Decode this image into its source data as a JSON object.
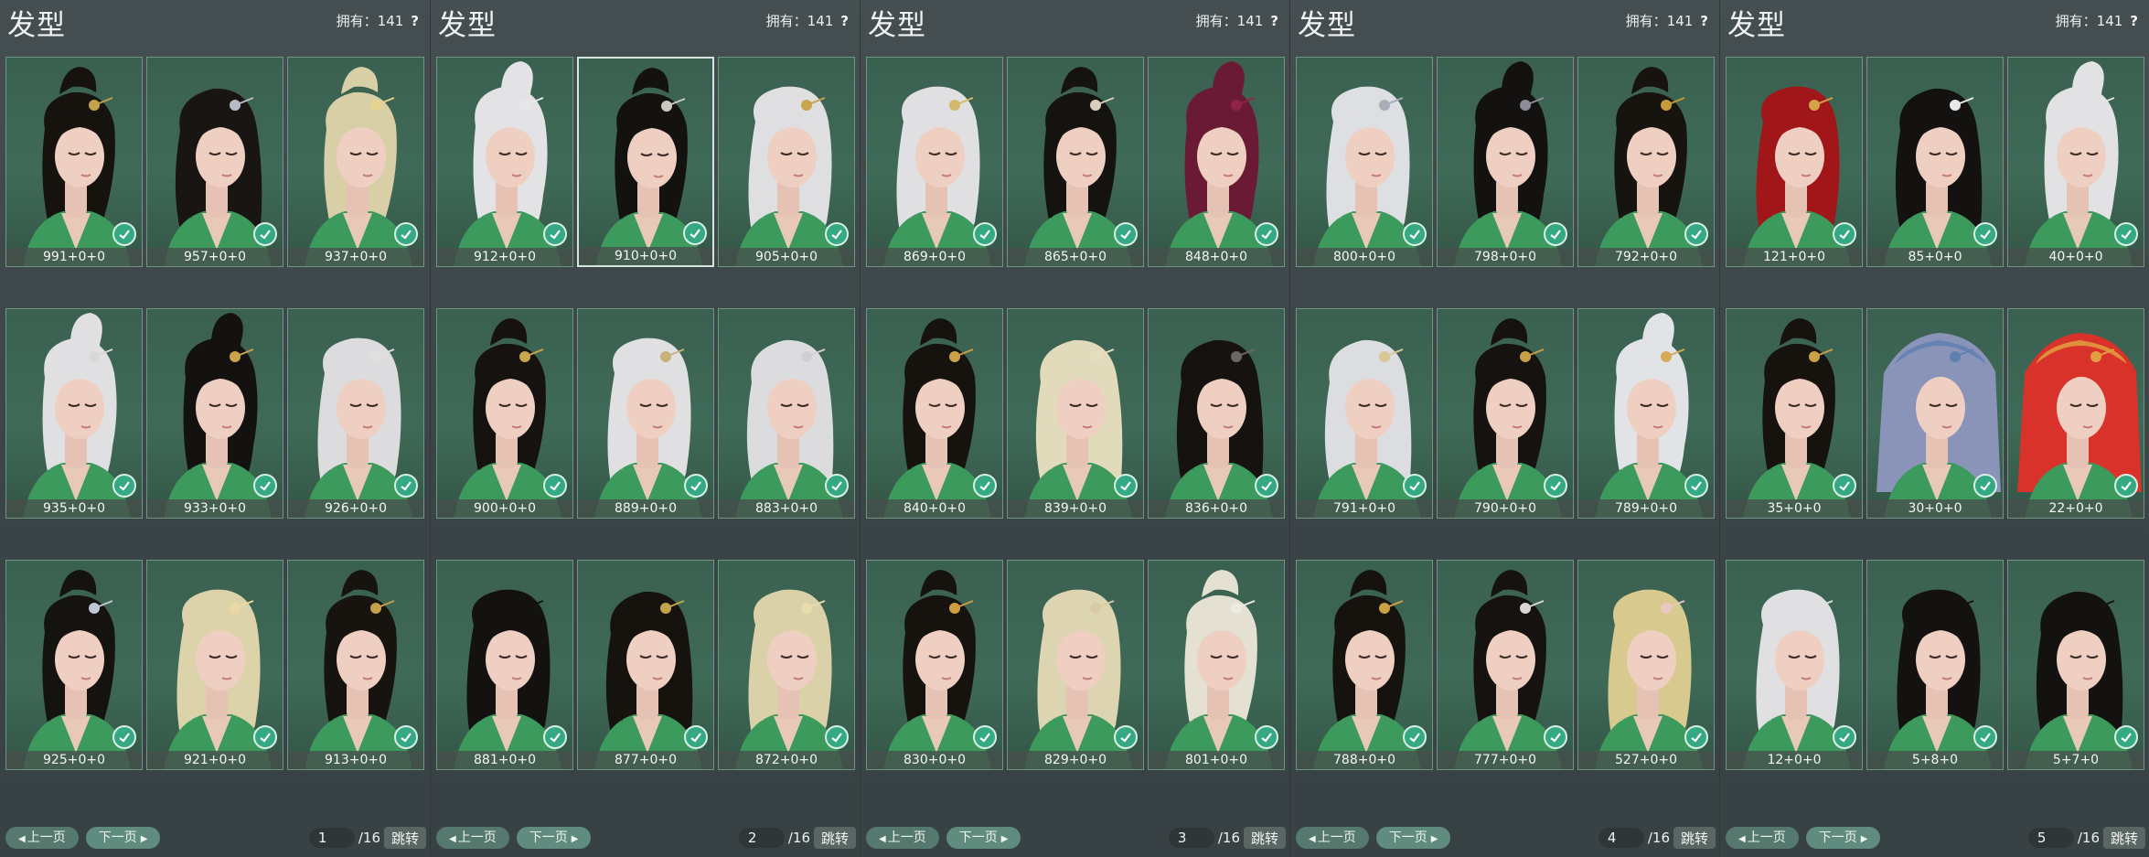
{
  "colors": {
    "panel_bg": "#3d4648",
    "card_bg": "#3f6a58",
    "card_border": "#6e9584",
    "check": "#35a884",
    "button": "#5f8c7e"
  },
  "panels": [
    {
      "title": "发型",
      "owned": "拥有：141",
      "help": "?",
      "page": "1",
      "total": "/16",
      "prev": "上一页",
      "next": "下一页",
      "jump": "跳转",
      "items": [
        {
          "code": "991+0+0",
          "hair": "#16130f",
          "acc": "#c6a248",
          "style": "bun",
          "selected": false
        },
        {
          "code": "957+0+0",
          "hair": "#181513",
          "acc": "#b8bac6",
          "style": "side",
          "selected": false
        },
        {
          "code": "937+0+0",
          "hair": "#d9cfa7",
          "acc": "#e6d38c",
          "style": "bun",
          "selected": false
        },
        {
          "code": "935+0+0",
          "hair": "#e0e0e2",
          "acc": "#d8d8d8",
          "style": "pony",
          "selected": false
        },
        {
          "code": "933+0+0",
          "hair": "#141210",
          "acc": "#c9a44c",
          "style": "pony",
          "selected": false
        },
        {
          "code": "926+0+0",
          "hair": "#dcdcdf",
          "acc": "#e0e0e0",
          "style": "long",
          "selected": false
        },
        {
          "code": "925+0+0",
          "hair": "#15130f",
          "acc": "#bfc7d6",
          "style": "bun",
          "selected": false
        },
        {
          "code": "921+0+0",
          "hair": "#ddd3ab",
          "acc": "#ead8a3",
          "style": "long",
          "selected": false
        },
        {
          "code": "913+0+0",
          "hair": "#17140f",
          "acc": "#c4a04c",
          "style": "bun",
          "selected": false
        }
      ]
    },
    {
      "title": "发型",
      "owned": "拥有：141",
      "help": "?",
      "page": "2",
      "total": "/16",
      "prev": "上一页",
      "next": "下一页",
      "jump": "跳转",
      "items": [
        {
          "code": "912+0+0",
          "hair": "#e3e3e6",
          "acc": "#e8e8ea",
          "style": "pony",
          "selected": false
        },
        {
          "code": "910+0+0",
          "hair": "#141210",
          "acc": "#cbc8c2",
          "style": "bun",
          "selected": true
        },
        {
          "code": "905+0+0",
          "hair": "#dfdfe1",
          "acc": "#caa44e",
          "style": "long",
          "selected": false
        },
        {
          "code": "900+0+0",
          "hair": "#15120f",
          "acc": "#c9a74e",
          "style": "bun",
          "selected": false
        },
        {
          "code": "889+0+0",
          "hair": "#e0e0e2",
          "acc": "#c7b27a",
          "style": "long",
          "selected": false
        },
        {
          "code": "883+0+0",
          "hair": "#dcdcdf",
          "acc": "#d0d0d4",
          "style": "side",
          "selected": false
        },
        {
          "code": "881+0+0",
          "hair": "#141210",
          "acc": "#141210",
          "style": "long",
          "selected": false
        },
        {
          "code": "877+0+0",
          "hair": "#16130f",
          "acc": "#c3a34e",
          "style": "side",
          "selected": false
        },
        {
          "code": "872+0+0",
          "hair": "#dad1a9",
          "acc": "#e9dcae",
          "style": "long",
          "selected": false
        }
      ]
    },
    {
      "title": "发型",
      "owned": "拥有：141",
      "help": "?",
      "page": "3",
      "total": "/16",
      "prev": "上一页",
      "next": "下一页",
      "jump": "跳转",
      "items": [
        {
          "code": "869+0+0",
          "hair": "#e0e0e3",
          "acc": "#d4b86c",
          "style": "long",
          "selected": false
        },
        {
          "code": "865+0+0",
          "hair": "#15130f",
          "acc": "#d8d0bc",
          "style": "bun",
          "selected": false
        },
        {
          "code": "848+0+0",
          "hair": "#6b1a36",
          "acc": "#8f2446",
          "style": "pony",
          "selected": false
        },
        {
          "code": "840+0+0",
          "hair": "#16120e",
          "acc": "#caa148",
          "style": "bun",
          "selected": false
        },
        {
          "code": "839+0+0",
          "hair": "#e1dbbc",
          "acc": "#e6dfbf",
          "style": "side",
          "selected": false
        },
        {
          "code": "836+0+0",
          "hair": "#15120f",
          "acc": "#6b6766",
          "style": "side",
          "selected": false
        },
        {
          "code": "830+0+0",
          "hair": "#16120e",
          "acc": "#cf9d3e",
          "style": "bun",
          "selected": false
        },
        {
          "code": "829+0+0",
          "hair": "#ddd5b1",
          "acc": "#d9c9a4",
          "style": "long",
          "selected": false
        },
        {
          "code": "801+0+0",
          "hair": "#e4e0d2",
          "acc": "#eeeae0",
          "style": "bun",
          "selected": false
        }
      ]
    },
    {
      "title": "发型",
      "owned": "拥有：141",
      "help": "?",
      "page": "4",
      "total": "/16",
      "prev": "上一页",
      "next": "下一页",
      "jump": "跳转",
      "items": [
        {
          "code": "800+0+0",
          "hair": "#dedfe3",
          "acc": "#a8adb8",
          "style": "long",
          "selected": false
        },
        {
          "code": "798+0+0",
          "hair": "#141210",
          "acc": "#8d8c98",
          "style": "pony",
          "selected": false
        },
        {
          "code": "792+0+0",
          "hair": "#17130f",
          "acc": "#c79a3c",
          "style": "bun",
          "selected": false
        },
        {
          "code": "791+0+0",
          "hair": "#dcdde1",
          "acc": "#d8c794",
          "style": "side",
          "selected": false
        },
        {
          "code": "790+0+0",
          "hair": "#15120f",
          "acc": "#c7a04a",
          "style": "bun",
          "selected": false
        },
        {
          "code": "789+0+0",
          "hair": "#e2e3e7",
          "acc": "#d5ab5a",
          "style": "pony",
          "selected": false
        },
        {
          "code": "788+0+0",
          "hair": "#16120e",
          "acc": "#caa044",
          "style": "bun",
          "selected": false
        },
        {
          "code": "777+0+0",
          "hair": "#15120f",
          "acc": "#d8d8d8",
          "style": "bun",
          "selected": false
        },
        {
          "code": "527+0+0",
          "hair": "#d8c98f",
          "acc": "#e8c8c0",
          "style": "long",
          "selected": false
        }
      ]
    },
    {
      "title": "发型",
      "owned": "拥有：141",
      "help": "?",
      "page": "5",
      "total": "/16",
      "prev": "上一页",
      "next": "下一页",
      "jump": "跳转",
      "items": [
        {
          "code": "121+0+0",
          "hair": "#a11618",
          "acc": "#d4a24a",
          "style": "long",
          "selected": false
        },
        {
          "code": "85+0+0",
          "hair": "#141210",
          "acc": "#e8e8ea",
          "style": "side",
          "selected": false
        },
        {
          "code": "40+0+0",
          "hair": "#e2e2e5",
          "acc": "#e2e2e5",
          "style": "pony",
          "selected": false
        },
        {
          "code": "35+0+0",
          "hair": "#16120e",
          "acc": "#c9a149",
          "style": "bun",
          "selected": false
        },
        {
          "code": "30+0+0",
          "hair": "#8a93b8",
          "acc": "#5f7fb0",
          "style": "veil",
          "selected": false
        },
        {
          "code": "22+0+0",
          "hair": "#d8322a",
          "acc": "#e2a040",
          "style": "veil",
          "selected": false
        },
        {
          "code": "12+0+0",
          "hair": "#e0e0e3",
          "acc": "#e0e0e3",
          "style": "long",
          "selected": false
        },
        {
          "code": "5+8+0",
          "hair": "#141210",
          "acc": "#141210",
          "style": "long",
          "selected": false
        },
        {
          "code": "5+7+0",
          "hair": "#141210",
          "acc": "#141210",
          "style": "side",
          "selected": false
        }
      ]
    }
  ]
}
